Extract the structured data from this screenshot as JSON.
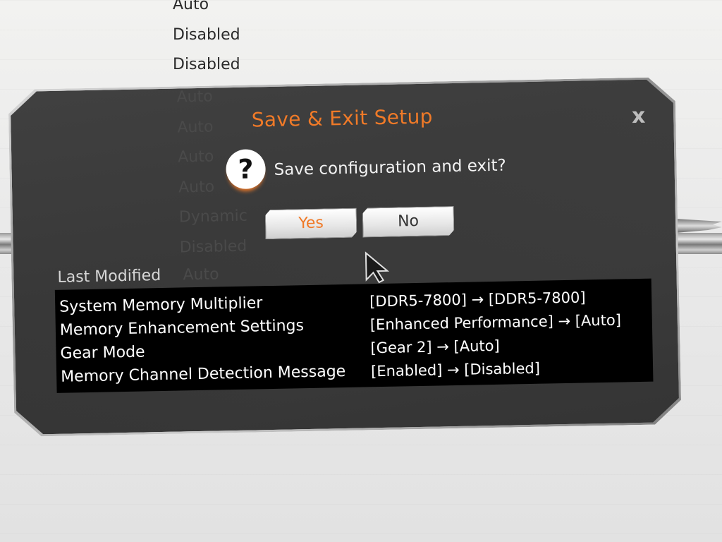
{
  "background_values": [
    "Auto",
    "Disabled",
    "Disabled"
  ],
  "ghost_values": [
    "Auto",
    "Auto",
    "Auto",
    "Auto",
    "Dynamic",
    "Disabled"
  ],
  "dialog": {
    "title": "Save & Exit Setup",
    "question": "Save configuration and exit?",
    "yes_label": "Yes",
    "no_label": "No",
    "close_glyph": "x",
    "question_glyph": "?",
    "last_modified_label": "Last Modified",
    "last_modified_ghost": "Auto",
    "changes": [
      {
        "name": "System Memory Multiplier",
        "value": "[DDR5-7800] → [DDR5-7800]"
      },
      {
        "name": "Memory Enhancement Settings",
        "value": "[Enhanced Performance] → [Auto]"
      },
      {
        "name": "Gear Mode",
        "value": "[Gear 2] → [Auto]"
      },
      {
        "name": "Memory Channel Detection Message",
        "value": "[Enabled] → [Disabled]"
      }
    ]
  },
  "colors": {
    "accent": "#f07a28",
    "dialog_bg": "#3a3a3a",
    "changes_bg": "#000000"
  },
  "icons": {
    "close": "close-icon",
    "question": "question-icon",
    "cursor": "mouse-pointer-icon"
  }
}
